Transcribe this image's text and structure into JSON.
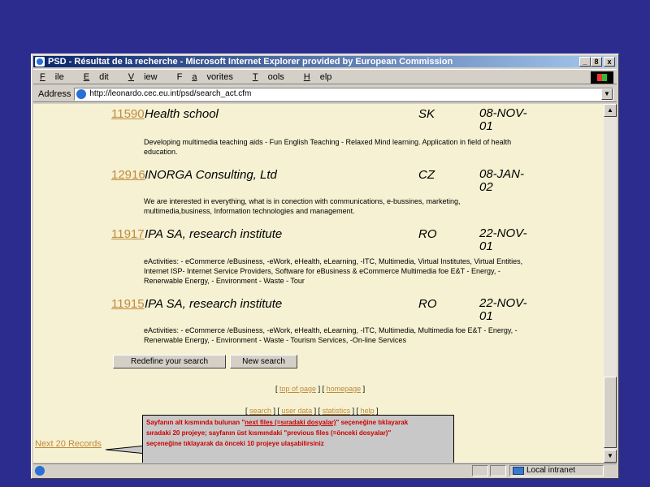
{
  "window": {
    "title": "PSD - Résultat de la recherche - Microsoft Internet Explorer provided by European Commission",
    "controls": [
      "_",
      "8",
      "x"
    ]
  },
  "menu": [
    {
      "label": "File",
      "key": "F"
    },
    {
      "label": "Edit",
      "key": "E"
    },
    {
      "label": "View",
      "key": "V"
    },
    {
      "label": "Favorites",
      "key": "a"
    },
    {
      "label": "Tools",
      "key": "T"
    },
    {
      "label": "Help",
      "key": "H"
    }
  ],
  "address": {
    "label": "Address",
    "url": "http://leonardo.cec.eu.int/psd/search_act.cfm"
  },
  "records": [
    {
      "id": "11590",
      "name": "Health school",
      "country": "SK",
      "date": "08-NOV-01",
      "description": "Developing multimedia teaching aids - Fun English Teaching - Relaxed Mind learning. Application in field of health education."
    },
    {
      "id": "12916",
      "name": "INORGA Consulting, Ltd",
      "country": "CZ",
      "date": "08-JAN-02",
      "description": "We are interested in everything, what is in conection with communications, e-bussines, marketing, multimedia,business, Information technologies and management."
    },
    {
      "id": "11917",
      "name": "IPA SA, research institute",
      "country": "RO",
      "date": "22-NOV-01",
      "description": "eActivities: - eCommerce /eBusiness, -eWork, eHealth, eLearning, -ITC, Multimedia, Virtual Institutes, Virtual Entities, Internet ISP- Internet Service Providers, Software for eBusiness & eCommerce Multimedia foe E&T - Energy, - Renerwable Energy, - Environment - Waste - Tour"
    },
    {
      "id": "11915",
      "name": "IPA SA, research institute",
      "country": "RO",
      "date": "22-NOV-01",
      "description": "eActivities: - eCommerce /eBusiness, -eWork, eHealth, eLearning, -ITC, Multimedia, Multimedia foe E&T - Energy, - Renerwable Energy, - Environment - Waste - Tourism Services, -On-line Services"
    }
  ],
  "buttons": {
    "redefine": "Redefine your search",
    "new_search": "New search"
  },
  "links1": {
    "top": "top of page",
    "home": "homepage"
  },
  "links2": {
    "search": "search",
    "user_data": "user data",
    "statistics": "statistics",
    "help": "help"
  },
  "next_records": "Next 20 Records",
  "callout": {
    "line1_pre": "Sayfanın alt kısmında bulunan \"",
    "line1_link": "next files (=sıradaki dosyalar)",
    "line1_post": "\" seçeneğine tıklayarak",
    "line2": "sıradaki 20 projeye; sayfanın üst kısmındaki \"previous files (=önceki dosyalar)\"",
    "line3": "seçeneğine tıklayarak da önceki 10 projeye ulaşabilirsiniz"
  },
  "status": {
    "zone": "Local intranet"
  },
  "colors": {
    "desktop": "#2c2c8e",
    "page_bg": "#f5f1d2",
    "link": "#c08a3c",
    "titlebar": "#0a246a",
    "callout_text": "#cc0000"
  }
}
